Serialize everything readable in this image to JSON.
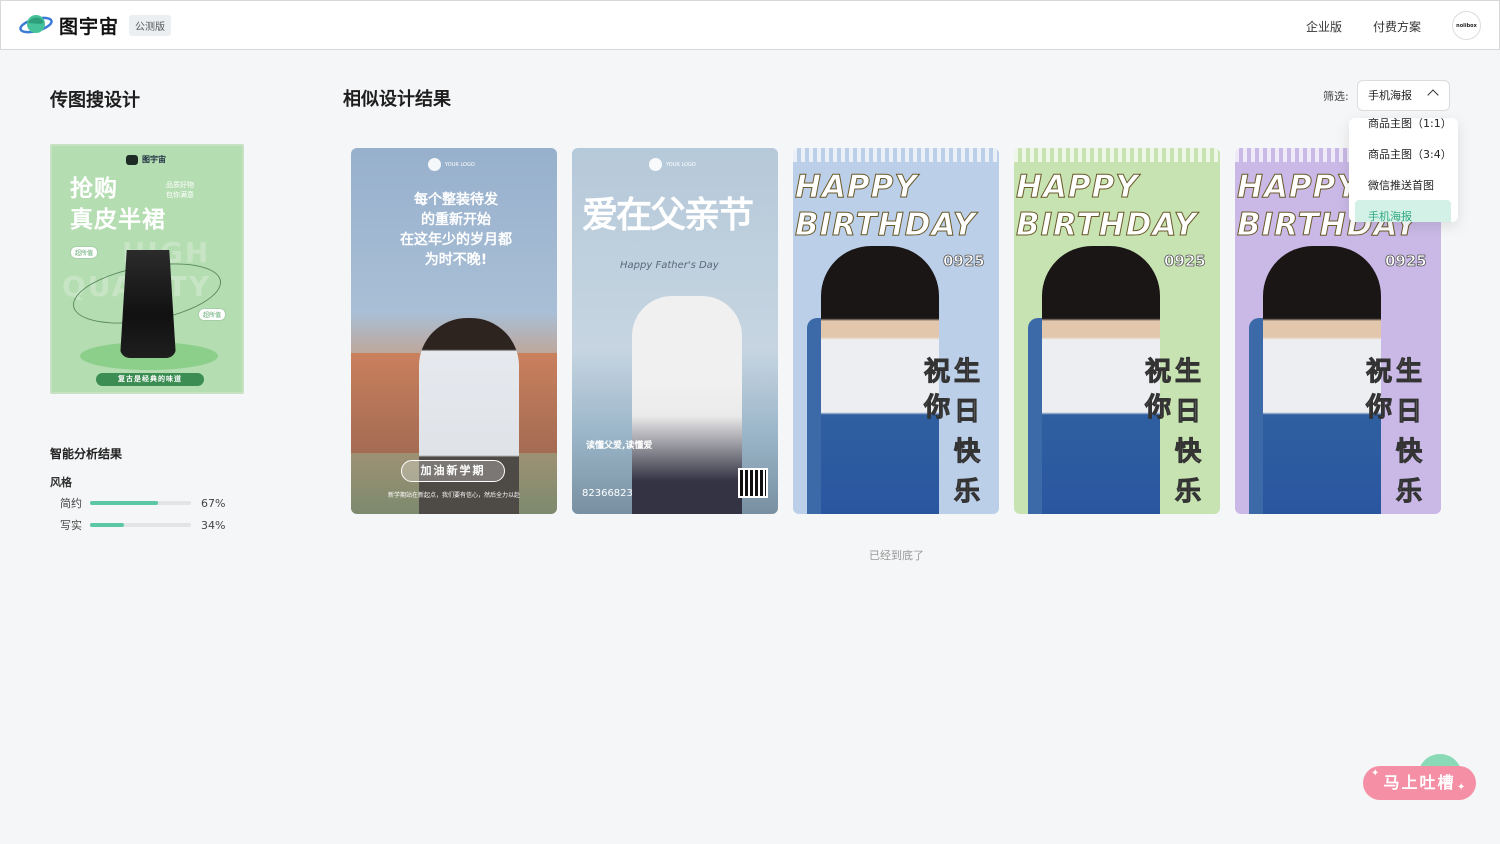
{
  "header": {
    "brand": "图宇宙",
    "beta_badge": "公测版",
    "nav": [
      "企业版",
      "付费方案"
    ],
    "avatar_text": "nolibox"
  },
  "left": {
    "title": "传图搜设计",
    "query_image": {
      "brand": "图宇宙",
      "headline_line1": "抢购",
      "headline_line2": "真皮半裙",
      "side_line1": "品质好物",
      "side_line2": "包你满意",
      "tag_left": "超所值",
      "tag_right": "超所值",
      "ghost_line1": "HIGH",
      "ghost_line2": "QUALITY",
      "footer": "复古是经典的味道"
    },
    "analysis": {
      "title": "智能分析结果",
      "style_label": "风格",
      "rows": [
        {
          "name": "简约",
          "value": 0.67,
          "percent": "67%"
        },
        {
          "name": "写实",
          "value": 0.34,
          "percent": "34%"
        }
      ]
    }
  },
  "main": {
    "title": "相似设计结果",
    "filter_label": "筛选:",
    "filter_value": "手机海报",
    "dropdown_options": [
      "商品主图（1:1）",
      "商品主图（3:4）",
      "微信推送首图",
      "手机海报"
    ],
    "dropdown_active": "手机海报",
    "cards": [
      {
        "logo": "YOUR LOGO",
        "headline": [
          "每个整装待发",
          "的重新开始",
          "在这年少的岁月都",
          "为时不晚!"
        ],
        "pill": "加油新学期",
        "footer": "新学期站在新起点，我们要有信心，然后全力以赴"
      },
      {
        "logo": "YOUR LOGO",
        "title": "爱在父亲节",
        "subtitle": "Happy Father's Day",
        "tag": "读懂父爱,读懂爱",
        "phone": "82366823"
      },
      {
        "title": "HAPPY BIRTHDAY",
        "date": "0925",
        "cjk": [
          "祝",
          "生",
          "你",
          "日",
          "快",
          "乐"
        ]
      },
      {
        "title": "HAPPY BIRTHDAY",
        "date": "0925",
        "cjk": [
          "祝",
          "生",
          "你",
          "日",
          "快",
          "乐"
        ]
      },
      {
        "title": "HAPPY BIRTHDAY",
        "date": "0925",
        "cjk": [
          "祝",
          "生",
          "你",
          "日",
          "快",
          "乐"
        ]
      }
    ],
    "end_text": "已经到底了"
  },
  "feedback_button": "马上吐槽",
  "colors": {
    "accent": "#5cc7a5",
    "dropdown_active_bg": "#d3f1e6",
    "dropdown_active_text": "#31a983",
    "feedback": "#f58fa5"
  }
}
